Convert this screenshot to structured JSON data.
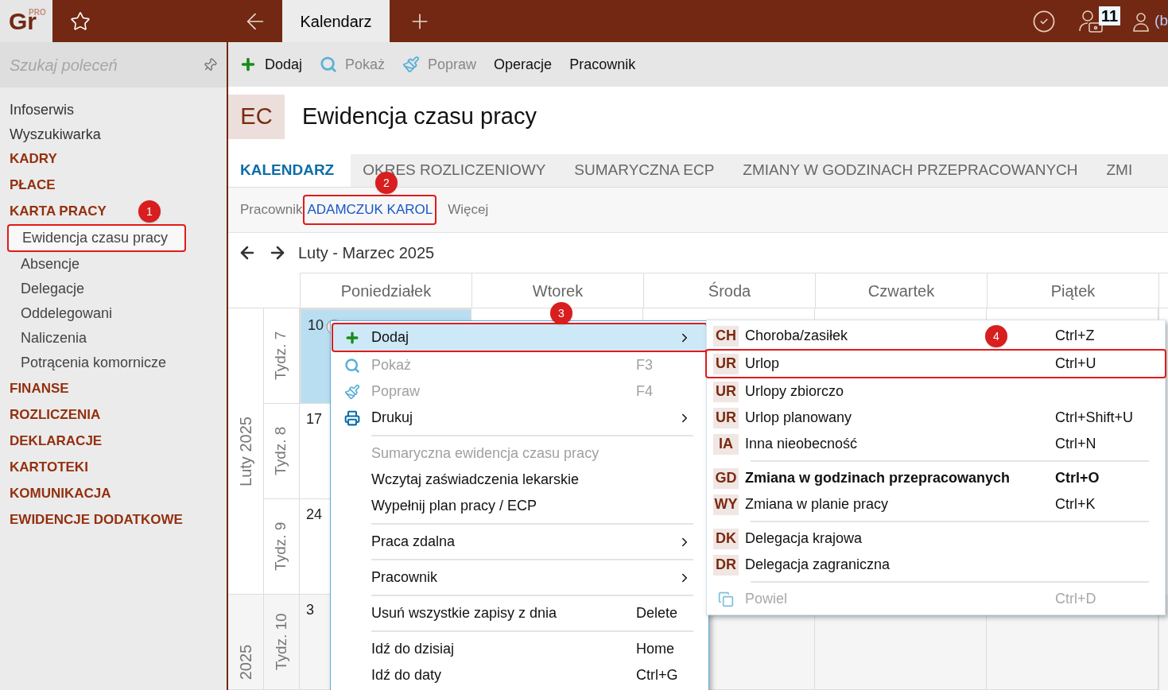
{
  "app": {
    "logo": "Gr",
    "logo_badge": "PRO"
  },
  "top_tabs": [
    {
      "label": "Kalendarz",
      "selected": true
    }
  ],
  "top_right": {
    "badge_count": "11",
    "user_text": "(b"
  },
  "sidebar": {
    "search_placeholder": "Szukaj poleceń",
    "items": [
      {
        "label": "Infoserwis",
        "kind": "link"
      },
      {
        "label": "Wyszukiwarka",
        "kind": "link"
      },
      {
        "label": "KADRY",
        "kind": "section"
      },
      {
        "label": "PŁACE",
        "kind": "section"
      },
      {
        "label": "KARTA PRACY",
        "kind": "section",
        "children": [
          {
            "label": "Ewidencja czasu pracy",
            "selected": true,
            "annotation": "1"
          },
          {
            "label": "Absencje",
            "selected": false
          },
          {
            "label": "Delegacje",
            "selected": false
          },
          {
            "label": "Oddelegowani",
            "selected": false
          },
          {
            "label": "Naliczenia",
            "selected": false
          },
          {
            "label": "Potrącenia komornicze",
            "selected": false
          }
        ]
      },
      {
        "label": "FINANSE",
        "kind": "section"
      },
      {
        "label": "ROZLICZENIA",
        "kind": "section"
      },
      {
        "label": "DEKLARACJE",
        "kind": "section"
      },
      {
        "label": "KARTOTEKI",
        "kind": "section"
      },
      {
        "label": "KOMUNIKACJA",
        "kind": "section"
      },
      {
        "label": "EWIDENCJE DODATKOWE",
        "kind": "section"
      }
    ]
  },
  "toolbar": [
    {
      "label": "Dodaj",
      "kind": "add",
      "disabled": false
    },
    {
      "label": "Pokaż",
      "kind": "show",
      "disabled": true
    },
    {
      "label": "Popraw",
      "kind": "edit",
      "disabled": true
    },
    {
      "label": "Operacje",
      "kind": "plain",
      "disabled": false
    },
    {
      "label": "Pracownik",
      "kind": "plain",
      "disabled": false
    }
  ],
  "page": {
    "badge": "EC",
    "title": "Ewidencja czasu pracy"
  },
  "tabs": [
    {
      "label": "KALENDARZ",
      "selected": true
    },
    {
      "label": "OKRES ROZLICZENIOWY",
      "selected": false
    },
    {
      "label": "SUMARYCZNA ECP",
      "selected": false
    },
    {
      "label": "ZMIANY W GODZINACH PRZEPRACOWANYCH",
      "selected": false
    },
    {
      "label": "ZMI",
      "selected": false
    }
  ],
  "filter": {
    "label": "Pracownik",
    "value": "ADAMCZUK KAROL",
    "more": "Więcej",
    "annotation": "2"
  },
  "period": "Luty - Marzec 2025",
  "calendar": {
    "days": [
      "Poniedziałek",
      "Wtorek",
      "Środa",
      "Czwartek",
      "Piątek"
    ],
    "months": [
      {
        "label": "Luty 2025",
        "weeks": [
          {
            "label": "Tydz. 7",
            "day": "10",
            "selected": true
          },
          {
            "label": "Tydz. 8",
            "day": "17",
            "selected": false
          },
          {
            "label": "Tydz. 9",
            "day": "24",
            "selected": false
          }
        ]
      },
      {
        "label": "2025",
        "weeks": [
          {
            "label": "Tydz. 10",
            "day": "3",
            "selected": false
          }
        ]
      }
    ]
  },
  "context_menu": {
    "annotation": "3",
    "items": [
      {
        "label": "Dodaj",
        "kind": "add",
        "submenu": true,
        "disabled": false,
        "selected": true,
        "separator_before": false
      },
      {
        "label": "Pokaż",
        "kind": "show",
        "shortcut": "F3",
        "submenu": false,
        "disabled": true,
        "selected": false,
        "separator_before": false
      },
      {
        "label": "Popraw",
        "kind": "edit",
        "shortcut": "F4",
        "submenu": false,
        "disabled": true,
        "selected": false,
        "separator_before": false
      },
      {
        "label": "Drukuj",
        "kind": "print",
        "submenu": true,
        "disabled": false,
        "selected": false,
        "separator_before": false
      },
      {
        "label": "Sumaryczna ewidencja czasu pracy",
        "kind": "plain",
        "submenu": false,
        "disabled": true,
        "selected": false,
        "separator_before": true
      },
      {
        "label": "Wczytaj zaświadczenia lekarskie",
        "kind": "plain",
        "submenu": false,
        "disabled": false,
        "selected": false,
        "separator_before": false
      },
      {
        "label": "Wypełnij plan pracy / ECP",
        "kind": "plain",
        "submenu": false,
        "disabled": false,
        "selected": false,
        "separator_before": false
      },
      {
        "label": "Praca zdalna",
        "kind": "plain",
        "submenu": true,
        "disabled": false,
        "selected": false,
        "separator_before": true
      },
      {
        "label": "Pracownik",
        "kind": "plain",
        "submenu": true,
        "disabled": false,
        "selected": false,
        "separator_before": true
      },
      {
        "label": "Usuń wszystkie zapisy z dnia",
        "kind": "plain",
        "shortcut": "Delete",
        "submenu": false,
        "disabled": false,
        "selected": false,
        "separator_before": true
      },
      {
        "label": "Idź do dzisiaj",
        "kind": "plain",
        "shortcut": "Home",
        "submenu": false,
        "disabled": false,
        "selected": false,
        "separator_before": true
      },
      {
        "label": "Idź do daty",
        "kind": "plain",
        "shortcut": "Ctrl+G",
        "submenu": false,
        "disabled": false,
        "selected": false,
        "separator_before": false
      }
    ]
  },
  "submenu": {
    "items": [
      {
        "code": "CH",
        "label": "Choroba/zasiłek",
        "shortcut": "Ctrl+Z",
        "bold": false,
        "disabled": false,
        "selected": false,
        "separator_before": false
      },
      {
        "code": "UR",
        "label": "Urlop",
        "shortcut": "Ctrl+U",
        "bold": false,
        "disabled": false,
        "selected": true,
        "annotation": "4",
        "separator_before": false
      },
      {
        "code": "UR",
        "label": "Urlopy zbiorczo",
        "bold": false,
        "disabled": false,
        "selected": false,
        "separator_before": false
      },
      {
        "code": "UR",
        "label": "Urlop planowany",
        "shortcut": "Ctrl+Shift+U",
        "bold": false,
        "disabled": false,
        "selected": false,
        "separator_before": false
      },
      {
        "code": "IA",
        "label": "Inna nieobecność",
        "shortcut": "Ctrl+N",
        "bold": false,
        "disabled": false,
        "selected": false,
        "separator_before": false
      },
      {
        "code": "GD",
        "label": "Zmiana w godzinach przepracowanych",
        "shortcut": "Ctrl+O",
        "bold": true,
        "disabled": false,
        "selected": false,
        "separator_before": true
      },
      {
        "code": "WY",
        "label": "Zmiana w planie pracy",
        "shortcut": "Ctrl+K",
        "bold": false,
        "disabled": false,
        "selected": false,
        "separator_before": false
      },
      {
        "code": "DK",
        "label": "Delegacja krajowa",
        "bold": false,
        "disabled": false,
        "selected": false,
        "separator_before": true
      },
      {
        "code": "DR",
        "label": "Delegacja zagraniczna",
        "bold": false,
        "disabled": false,
        "selected": false,
        "separator_before": false
      },
      {
        "kind": "copy",
        "label": "Powiel",
        "shortcut": "Ctrl+D",
        "bold": false,
        "disabled": true,
        "selected": false,
        "separator_before": true
      }
    ]
  }
}
